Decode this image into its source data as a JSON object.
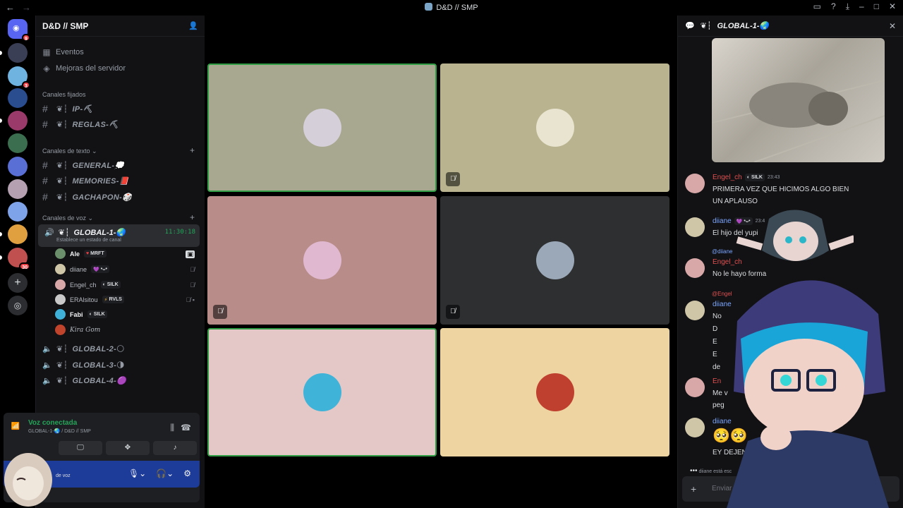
{
  "window": {
    "title": "D&D // SMP"
  },
  "server": {
    "name": "D&D // SMP"
  },
  "sidebar": {
    "top_items": [
      {
        "label": "Eventos"
      },
      {
        "label": "Mejoras del servidor"
      }
    ],
    "pinned_category": "Canales fijados",
    "pinned_channels": [
      {
        "name": "IP-⛏"
      },
      {
        "name": "REGLAS-⛏"
      }
    ],
    "text_category": "Canales de texto",
    "text_channels": [
      {
        "name": "GENERAL-💭"
      },
      {
        "name": "MEMORIES-📕"
      },
      {
        "name": "GACHAPON-🎲"
      }
    ],
    "voice_category": "Canales de voz",
    "active_voice": {
      "name": "GLOBAL-1-🌏",
      "time": "11:30:18",
      "status": "Establece un estado de canal"
    },
    "voice_users": [
      {
        "name": "Ale",
        "tag": "MRFT",
        "tag_icon": "♥",
        "avatar_color": "#6a8f6a"
      },
      {
        "name": "diiane",
        "tag": "•ᴗ•",
        "tag_icon": "💜",
        "avatar_color": "#cfc6a8"
      },
      {
        "name": "Engel_ch",
        "tag": "SILK",
        "tag_icon": "◐",
        "avatar_color": "#d8a8a8"
      },
      {
        "name": "ERAlsitou",
        "tag": "RVLS",
        "tag_icon": "⚡",
        "avatar_color": "#c9c9c9"
      },
      {
        "name": "Fabi",
        "tag": "SILK",
        "tag_icon": "◐",
        "avatar_color": "#3fb0d8"
      },
      {
        "name": "Kira Gom",
        "tag": "",
        "tag_icon": "",
        "avatar_color": "#c0432b"
      }
    ],
    "other_voice": [
      {
        "name": "GLOBAL-2-🌕"
      },
      {
        "name": "GLOBAL-3-🌗"
      },
      {
        "name": "GLOBAL-4-🟣"
      }
    ]
  },
  "servers": [
    {
      "badge": "9",
      "color": "#5865f2"
    },
    {
      "badge": "",
      "color": "#3a3f55"
    },
    {
      "badge": "3",
      "color": "#6fb3e0"
    },
    {
      "badge": "",
      "color": "#2a4d8f"
    },
    {
      "badge": "",
      "color": "#9a3a6a"
    },
    {
      "badge": "",
      "color": "#3b6e4f"
    },
    {
      "badge": "",
      "color": "#5a6fd6"
    },
    {
      "badge": "",
      "color": "#b4a0b0"
    },
    {
      "badge": "",
      "color": "#7ea3e8"
    },
    {
      "badge": "",
      "color": "#e0a040"
    },
    {
      "badge": "30",
      "color": "#c05050"
    }
  ],
  "voice_panel": {
    "status": "Voz conectada",
    "location": "GLOBAL-1-🌏 / D&D // SMP",
    "user_sub": "de voz"
  },
  "tiles": [
    {
      "bg": "#a8a890",
      "avatar": "#d4cfd8",
      "selected": true,
      "muted": false
    },
    {
      "bg": "#b9b48f",
      "avatar": "#e8e4d0",
      "selected": false,
      "muted": true
    },
    {
      "bg": "#b88c88",
      "avatar": "#e0b8d0",
      "selected": false,
      "muted": true
    },
    {
      "bg": "#2d2f31",
      "avatar": "#9aa8b8",
      "selected": false,
      "muted": true
    },
    {
      "bg": "#e4c8c8",
      "avatar": "#3fb4d8",
      "selected": true,
      "muted": false
    },
    {
      "bg": "#eed4a0",
      "avatar": "#c04030",
      "selected": false,
      "muted": false
    }
  ],
  "chat": {
    "channel": "GLOBAL-1-🌏",
    "messages": [
      {
        "author": "Engel_ch",
        "author_color": "#e05050",
        "tag": "SILK",
        "time": "23:43",
        "lines": [
          "PRIMERA VEZ QUE HICIMOS ALGO BIEN",
          "UN APLAUSO"
        ],
        "avatar": "#d8a8a8"
      },
      {
        "author": "diiane",
        "author_color": "#7aa5ff",
        "tag": "•ᴗ•",
        "time": "23:4",
        "lines": [
          "El hijo del yupi"
        ],
        "avatar": "#cfc6a8"
      },
      {
        "author": "Engel_ch",
        "author_color": "#e05050",
        "tag": "SILK",
        "time": "",
        "lines": [
          "No le hayo forma"
        ],
        "avatar": "#d8a8a8",
        "reply": "@diiane"
      },
      {
        "author": "diiane",
        "author_color": "#7aa5ff",
        "tag": "",
        "time": "",
        "lines": [
          "No",
          "D",
          "E",
          "E",
          "de"
        ],
        "avatar": "#cfc6a8",
        "reply": "@Engel"
      },
      {
        "author": "En",
        "author_color": "#e05050",
        "tag": "",
        "time": "",
        "lines": [
          "Me v",
          "peg"
        ],
        "avatar": "#d8a8a8"
      },
      {
        "author": "diiane",
        "author_color": "#7aa5ff",
        "tag": "",
        "time": "",
        "lines": [
          "🥺🥺",
          "EY DEJENME"
        ],
        "avatar": "#cfc6a8"
      }
    ],
    "typing": "diiane está esc",
    "input_placeholder": "Enviar me"
  }
}
